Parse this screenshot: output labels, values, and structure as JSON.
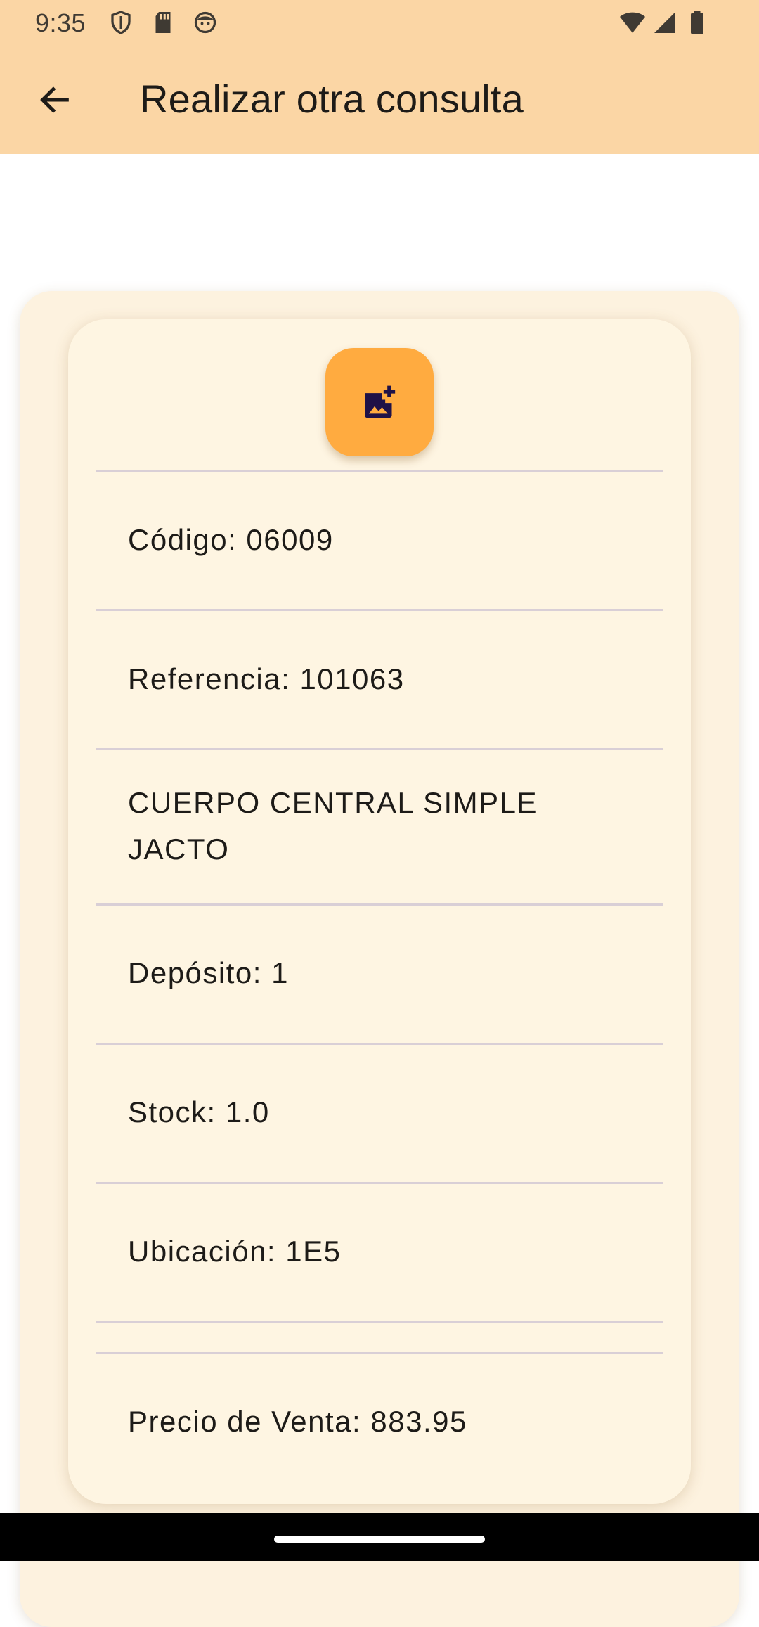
{
  "status_bar": {
    "time": "9:35",
    "icons": [
      "shield-icon",
      "sd-card-icon",
      "face-icon",
      "wifi-icon",
      "signal-icon",
      "battery-icon"
    ]
  },
  "toolbar": {
    "back_icon": "arrow-left-icon",
    "title": "Realizar otra consulta"
  },
  "colors": {
    "app_bar": "#fbd6a5",
    "outer_card": "#fdf2df",
    "inner_card": "#fef5e2",
    "fab": "#ffab40",
    "fab_icon": "#1f1147"
  },
  "fab": {
    "icon": "add-photo-icon"
  },
  "details": {
    "codigo": "Código: 06009",
    "referencia": "Referencia: 101063",
    "descripcion_line1": "CUERPO CENTRAL SIMPLE",
    "descripcion_line2": "JACTO",
    "deposito": "Depósito: 1",
    "stock": "Stock: 1.0",
    "ubicacion": "Ubicación: 1E5",
    "precio": "Precio de Venta: 883.95"
  }
}
